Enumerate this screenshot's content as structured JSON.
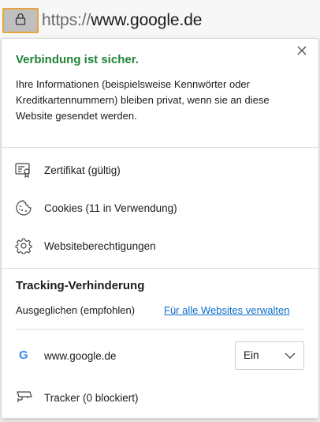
{
  "address_bar": {
    "url_scheme": "https://",
    "url_host": "www.google.de",
    "lock_icon": "lock-icon"
  },
  "panel": {
    "title": "Verbindung ist sicher.",
    "title_color": "#1f8437",
    "description": "Ihre Informationen (beispielsweise Kennwörter oder Kreditkartennummern) bleiben privat, wenn sie an diese Website gesendet werden.",
    "close_icon": "close-icon",
    "items": [
      {
        "label": "Zertifikat (gültig)",
        "icon": "certificate-icon"
      },
      {
        "label": "Cookies (11 in Verwendung)",
        "icon": "cookie-icon"
      },
      {
        "label": "Websiteberechtigungen",
        "icon": "gear-icon"
      }
    ],
    "tracking": {
      "title": "Tracking-Verhinderung",
      "mode": "Ausgeglichen (empfohlen)",
      "manage_link": "Für alle Websites verwalten",
      "link_color": "#0a6cc8",
      "site": {
        "icon_letter": "G",
        "name": "www.google.de"
      },
      "select_value": "Ein",
      "tracker_label": "Tracker (0 blockiert)",
      "tracker_icon": "camera-icon"
    }
  }
}
